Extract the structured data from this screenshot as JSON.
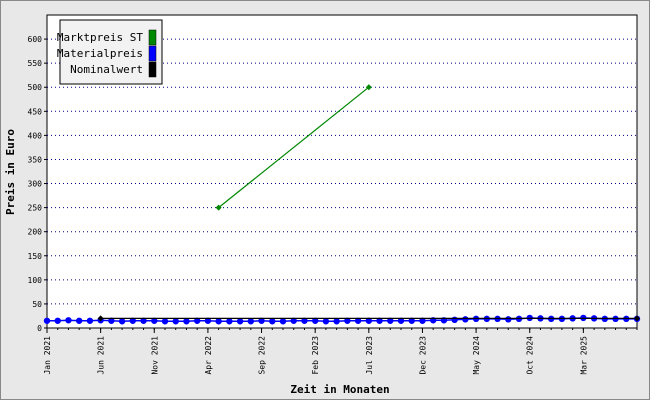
{
  "chart_data": {
    "type": "line",
    "title": "",
    "xlabel": "Zeit in Monaten",
    "ylabel": "Preis in Euro",
    "ylim": [
      0,
      650
    ],
    "yticks": [
      0,
      50,
      100,
      150,
      200,
      250,
      300,
      350,
      400,
      450,
      500,
      550,
      600
    ],
    "xlim": [
      "2021-01",
      "2025-08"
    ],
    "xtick_labels": [
      {
        "label": "Jan 2021",
        "date": "2021-01"
      },
      {
        "label": "Jun 2021",
        "date": "2021-06"
      },
      {
        "label": "Nov 2021",
        "date": "2021-11"
      },
      {
        "label": "Apr 2022",
        "date": "2022-04"
      },
      {
        "label": "Sep 2022",
        "date": "2022-09"
      },
      {
        "label": "Feb 2023",
        "date": "2023-02"
      },
      {
        "label": "Jul 2023",
        "date": "2023-07"
      },
      {
        "label": "Dec 2023",
        "date": "2023-12"
      },
      {
        "label": "May 2024",
        "date": "2024-05"
      },
      {
        "label": "Oct 2024",
        "date": "2024-10"
      },
      {
        "label": "Mar 2025",
        "date": "2025-03"
      }
    ],
    "grid": "horizontal dotted",
    "legend_position": "top-left",
    "series": [
      {
        "name": "Marktpreis ST",
        "color": "#008800",
        "points": [
          [
            "2022-05",
            250
          ],
          [
            "2023-07",
            500
          ]
        ]
      },
      {
        "name": "Materialpreis",
        "color": "#0000ff",
        "points": [
          [
            "2021-01",
            15
          ],
          [
            "2021-02",
            15
          ],
          [
            "2021-03",
            16
          ],
          [
            "2021-04",
            15
          ],
          [
            "2021-05",
            15
          ],
          [
            "2021-06",
            16
          ],
          [
            "2021-07",
            15
          ],
          [
            "2021-08",
            14
          ],
          [
            "2021-09",
            15
          ],
          [
            "2021-10",
            15
          ],
          [
            "2021-11",
            15
          ],
          [
            "2021-12",
            14
          ],
          [
            "2022-01",
            14
          ],
          [
            "2022-02",
            14
          ],
          [
            "2022-03",
            15
          ],
          [
            "2022-04",
            15
          ],
          [
            "2022-05",
            14
          ],
          [
            "2022-06",
            14
          ],
          [
            "2022-07",
            14
          ],
          [
            "2022-08",
            14
          ],
          [
            "2022-09",
            15
          ],
          [
            "2022-10",
            14
          ],
          [
            "2022-11",
            14
          ],
          [
            "2022-12",
            15
          ],
          [
            "2023-01",
            15
          ],
          [
            "2023-02",
            15
          ],
          [
            "2023-03",
            14
          ],
          [
            "2023-04",
            14
          ],
          [
            "2023-05",
            15
          ],
          [
            "2023-06",
            15
          ],
          [
            "2023-07",
            15
          ],
          [
            "2023-08",
            15
          ],
          [
            "2023-09",
            15
          ],
          [
            "2023-10",
            15
          ],
          [
            "2023-11",
            15
          ],
          [
            "2023-12",
            15
          ],
          [
            "2024-01",
            16
          ],
          [
            "2024-02",
            16
          ],
          [
            "2024-03",
            17
          ],
          [
            "2024-04",
            18
          ],
          [
            "2024-05",
            19
          ],
          [
            "2024-06",
            19
          ],
          [
            "2024-07",
            19
          ],
          [
            "2024-08",
            18
          ],
          [
            "2024-09",
            19
          ],
          [
            "2024-10",
            21
          ],
          [
            "2024-11",
            20
          ],
          [
            "2024-12",
            19
          ],
          [
            "2025-01",
            19
          ],
          [
            "2025-02",
            20
          ],
          [
            "2025-03",
            21
          ],
          [
            "2025-04",
            20
          ],
          [
            "2025-05",
            19
          ],
          [
            "2025-06",
            19
          ],
          [
            "2025-07",
            19
          ],
          [
            "2025-08",
            19
          ]
        ]
      },
      {
        "name": "Nominalwert",
        "color": "#000000",
        "points": [
          [
            "2021-06",
            20
          ],
          [
            "2025-08",
            20
          ]
        ]
      }
    ]
  }
}
